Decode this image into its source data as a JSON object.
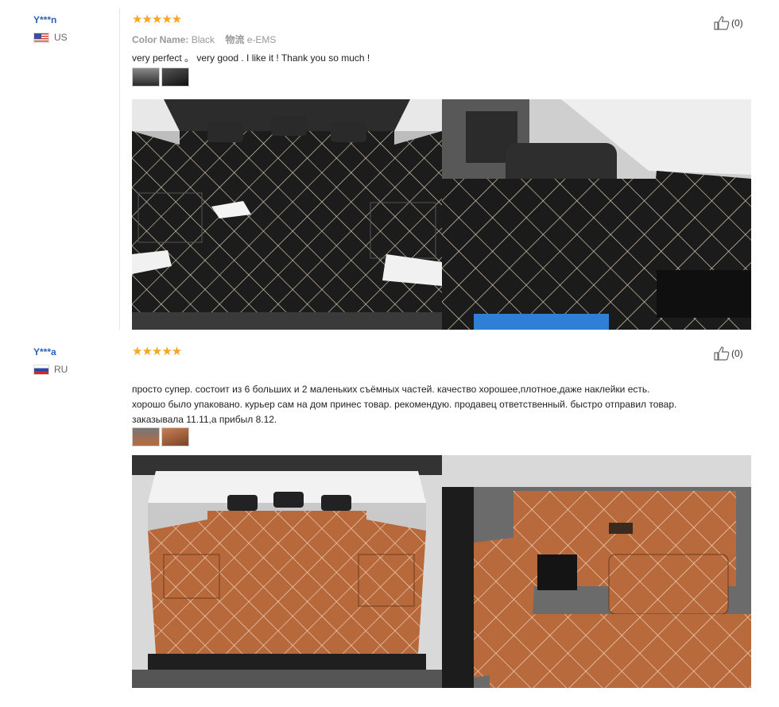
{
  "reviews": [
    {
      "user": "Y***n",
      "country": "US",
      "stars": "★★★★★",
      "color_label": "Color Name:",
      "color_value": "Black",
      "ship_label": "物流",
      "ship_value": "e-EMS",
      "text": "very perfect 。 very good . I like it ! Thank you so much !",
      "helpful_count": "(0)",
      "mat_color": "#1a1a1a",
      "stitch_color": "#e9dcc0"
    },
    {
      "user": "Y***a",
      "country": "RU",
      "stars": "★★★★★",
      "text_lines": [
        "просто супер. состоит из 6 больших и 2 маленьких съёмных частей. качество хорошее,плотное,даже наклейки есть.",
        "хорошо было упаковано. курьер сам на дом принес товар. рекомендую. продавец ответственный. быстро отправил товар.",
        "заказывала 11.11,а прибыл 8.12."
      ],
      "helpful_count": "(0)",
      "mat_color": "#b86a3c",
      "stitch_color": "#f3dcc4"
    }
  ],
  "colors": {
    "username": "#2b63b8",
    "star": "#f5a623",
    "divider": "#e6e6e6"
  }
}
